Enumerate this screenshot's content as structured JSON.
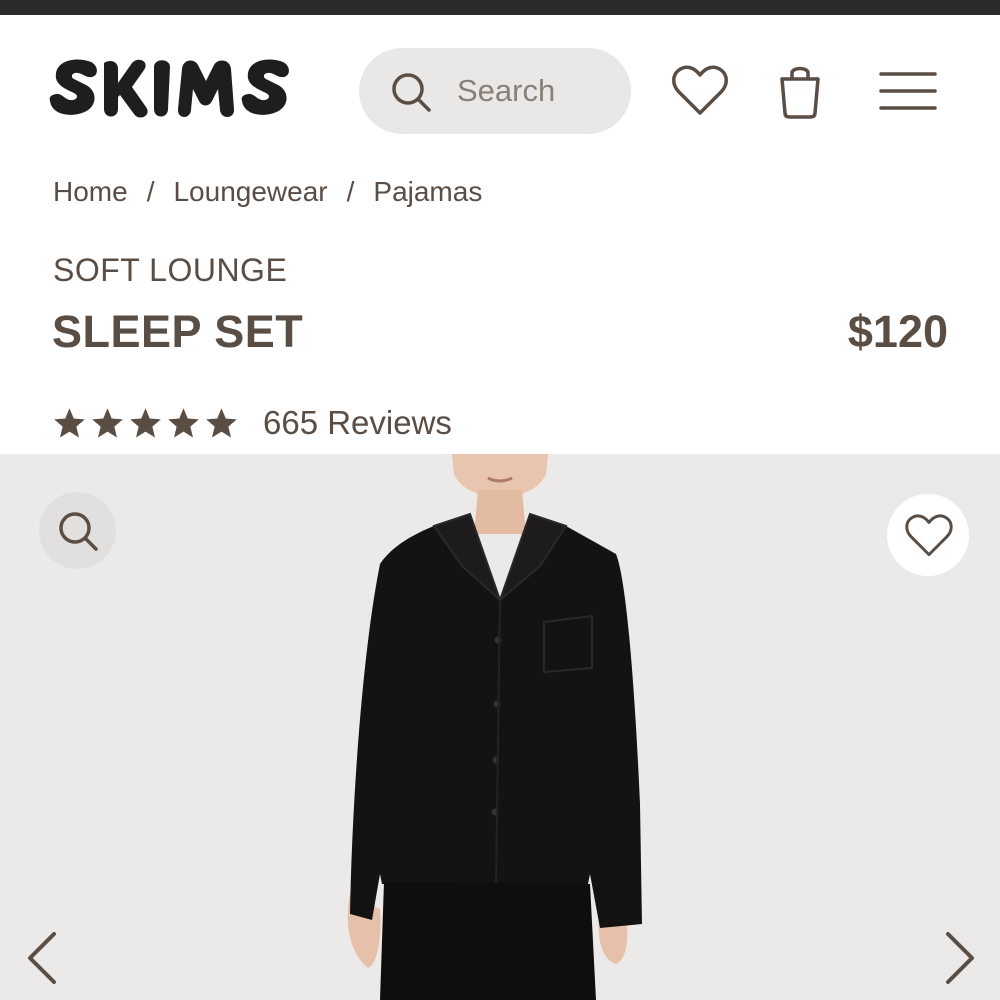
{
  "brand": {
    "logo_text": "SKIMS"
  },
  "header": {
    "search_placeholder": "Search",
    "icons": [
      "search-icon",
      "heart-icon",
      "bag-icon",
      "menu-icon"
    ]
  },
  "breadcrumb": {
    "items": [
      "Home",
      "Loungewear",
      "Pajamas"
    ],
    "separator": "/"
  },
  "product": {
    "collection": "SOFT LOUNGE",
    "name": "SLEEP SET",
    "price": "$120",
    "rating": 5,
    "reviews_label": "665 Reviews"
  },
  "gallery": {
    "icons": [
      "zoom-icon",
      "wishlist-heart-icon",
      "chevron-left-icon",
      "chevron-right-icon"
    ]
  },
  "colors": {
    "text": "#5a4d44",
    "topbar": "#2b2b2d",
    "search_bg": "#e9e8e6",
    "gallery_bg": "#eceae9",
    "garment": "#141313"
  }
}
